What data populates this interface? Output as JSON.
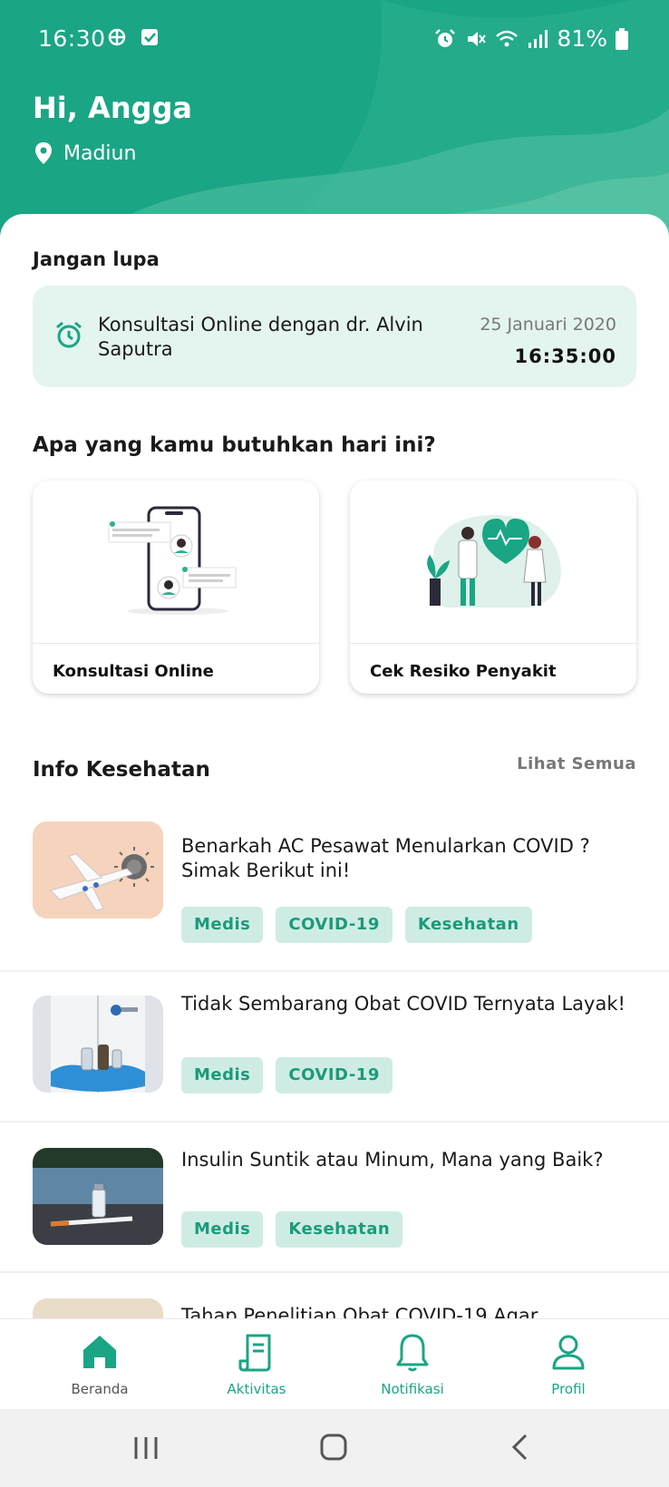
{
  "status_bar": {
    "time": "16:30",
    "battery": "81%"
  },
  "header": {
    "greeting": "Hi, Angga",
    "location": "Madiun"
  },
  "reminder_section": {
    "title": "Jangan lupa",
    "reminder": {
      "text": "Konsultasi Online dengan dr. Alvin Saputra",
      "date": "25 Januari 2020",
      "time": "16:35:00"
    }
  },
  "services_section": {
    "title": "Apa yang kamu butuhkan hari ini?",
    "cards": [
      {
        "label": "Konsultasi Online",
        "icon": "chat-phone-illustration"
      },
      {
        "label": "Cek Resiko Penyakit",
        "icon": "doctors-heart-illustration"
      }
    ]
  },
  "info_section": {
    "title": "Info Kesehatan",
    "see_all": "Lihat Semua",
    "articles": [
      {
        "title": "Benarkah AC Pesawat Menularkan COVID ? Simak Berikut ini!",
        "tags": [
          "Medis",
          "COVID-19",
          "Kesehatan"
        ],
        "thumb": "airplane-virus-image"
      },
      {
        "title": "Tidak Sembarang Obat COVID Ternyata Layak!",
        "tags": [
          "Medis",
          "COVID-19"
        ],
        "thumb": "gloved-hands-vials-image"
      },
      {
        "title": "Insulin Suntik atau Minum, Mana yang Baik?",
        "tags": [
          "Medis",
          "Kesehatan"
        ],
        "thumb": "insulin-syringe-image"
      },
      {
        "title": "Tahap Penelitian Obat COVID-19 Agar",
        "tags": [],
        "thumb": "research-image"
      }
    ]
  },
  "bottom_nav": {
    "items": [
      {
        "label": "Beranda",
        "icon": "home-icon"
      },
      {
        "label": "Aktivitas",
        "icon": "receipt-icon"
      },
      {
        "label": "Notifikasi",
        "icon": "bell-icon"
      },
      {
        "label": "Profil",
        "icon": "user-icon"
      }
    ]
  },
  "colors": {
    "primary": "#1aa584",
    "tag_bg": "#cfece4",
    "reminder_bg": "#e4f4ef"
  }
}
